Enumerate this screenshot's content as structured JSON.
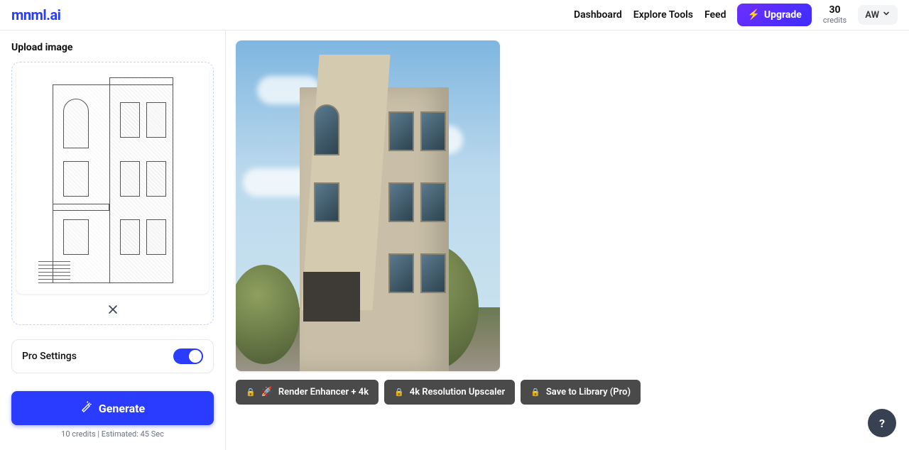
{
  "header": {
    "logo": "mnml.ai",
    "nav": {
      "dashboard": "Dashboard",
      "explore": "Explore Tools",
      "feed": "Feed"
    },
    "upgrade_label": "Upgrade",
    "credits_count": "30",
    "credits_label": "credits",
    "user_initials": "AW"
  },
  "sidebar": {
    "upload_title": "Upload image",
    "pro_settings_label": "Pro Settings",
    "generate_label": "Generate",
    "generate_info": "10 credits | Estimated: 45 Sec"
  },
  "actions": {
    "render_enhancer": "Render Enhancer + 4k",
    "upscaler": "4k Resolution Upscaler",
    "save_library": "Save to Library (Pro)"
  },
  "help": "?"
}
